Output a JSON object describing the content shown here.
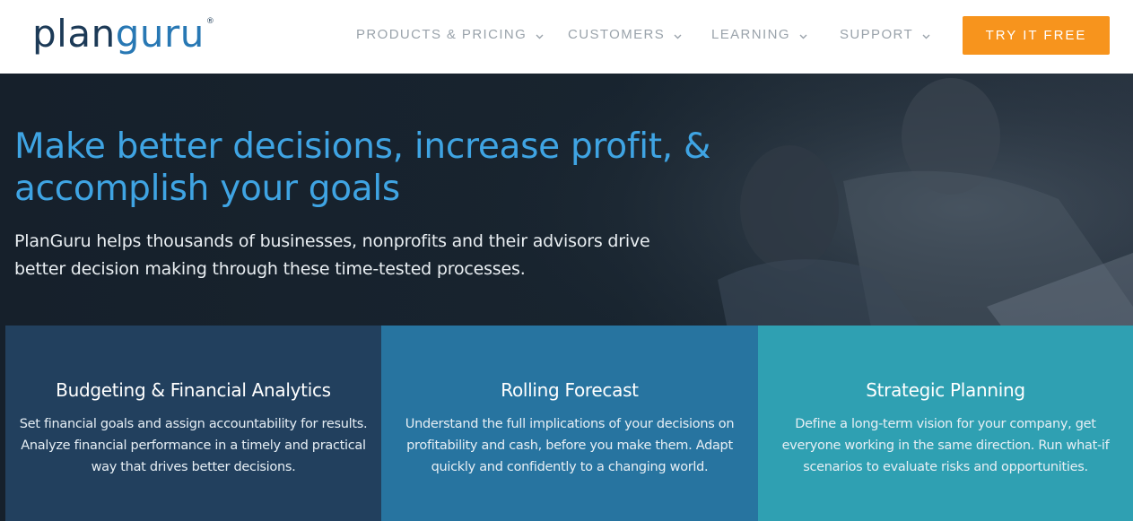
{
  "brand": {
    "logo_plan": "plan",
    "logo_guru": "guru",
    "logo_mark": "®",
    "logo_colors": [
      "#1c3a57",
      "#2878b4"
    ]
  },
  "nav": {
    "items": [
      {
        "label": "PRODUCTS & PRICING",
        "icon": "chevron-down-icon"
      },
      {
        "label": "CUSTOMERS",
        "icon": "chevron-down-icon"
      },
      {
        "label": "LEARNING",
        "icon": "chevron-down-icon"
      },
      {
        "label": "SUPPORT",
        "icon": "chevron-down-icon"
      }
    ],
    "cta_label": "TRY IT FREE",
    "cta_color": "#f7941d"
  },
  "hero": {
    "headline": "Make better decisions, increase profit, & accomplish your goals",
    "subhead": "PlanGuru helps thousands of businesses, nonprofits and their advisors drive better decision making through these time-tested processes."
  },
  "cards": [
    {
      "title": "Budgeting & Financial Analytics",
      "body": "Set financial goals and assign accountability for results. Analyze financial performance in a timely and practical way that drives better decisions.",
      "color": "#22405e"
    },
    {
      "title": "Rolling Forecast",
      "body": "Understand the full implications of your decisions on profitability and cash, before you make them. Adapt quickly and confidently to a changing world.",
      "color": "#2774a0"
    },
    {
      "title": "Strategic Planning",
      "body": "Define a long-term vision for your company, get everyone working in the same direction. Run what-if scenarios to evaluate risks and opportunities.",
      "color": "#2fa0b2"
    }
  ]
}
